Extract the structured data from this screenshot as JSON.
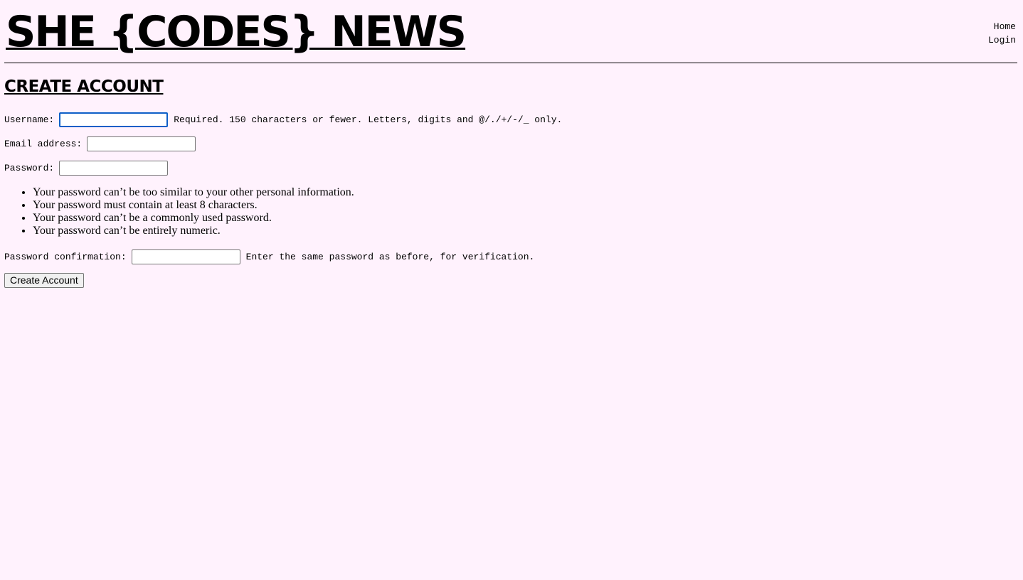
{
  "header": {
    "site_title": "SHE {CODES} NEWS",
    "nav": {
      "home": "Home",
      "login": "Login"
    }
  },
  "main": {
    "page_title": "CREATE ACCOUNT",
    "form": {
      "username": {
        "label": "Username:",
        "value": "",
        "help": "Required. 150 characters or fewer. Letters, digits and @/./+/-/_ only."
      },
      "email": {
        "label": "Email address:",
        "value": ""
      },
      "password": {
        "label": "Password:",
        "value": "",
        "help_items": [
          "Your password can’t be too similar to your other personal information.",
          "Your password must contain at least 8 characters.",
          "Your password can’t be a commonly used password.",
          "Your password can’t be entirely numeric."
        ]
      },
      "password_confirmation": {
        "label": "Password confirmation:",
        "value": "",
        "help": "Enter the same password as before, for verification."
      },
      "submit_label": "Create Account"
    }
  }
}
